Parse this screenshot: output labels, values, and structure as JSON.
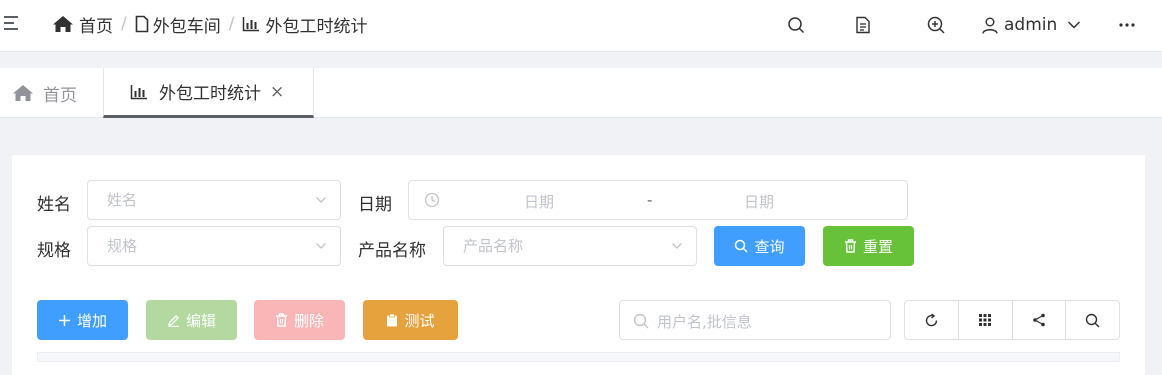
{
  "breadcrumb": {
    "items": [
      "首页",
      "外包车间",
      "外包工时统计"
    ],
    "separator": "/"
  },
  "user": {
    "name": "admin"
  },
  "tabs": [
    {
      "label": "首页"
    },
    {
      "label": "外包工时统计",
      "close": "×"
    }
  ],
  "filters": {
    "name_label": "姓名",
    "name_placeholder": "姓名",
    "date_label": "日期",
    "date_start_placeholder": "日期",
    "date_sep": "-",
    "date_end_placeholder": "日期",
    "spec_label": "规格",
    "spec_placeholder": "规格",
    "product_label": "产品名称",
    "product_placeholder": "产品名称",
    "query_label": "查询",
    "reset_label": "重置"
  },
  "toolbar": {
    "add_label": "增加",
    "edit_label": "编辑",
    "delete_label": "删除",
    "test_label": "测试",
    "search_placeholder": "用户名,批信息"
  },
  "colors": {
    "primary": "#409eff",
    "success": "#67c23a",
    "warning": "#e6a23c",
    "primary_disabled": "#b3d8a0",
    "danger_disabled": "#fab6b6"
  }
}
